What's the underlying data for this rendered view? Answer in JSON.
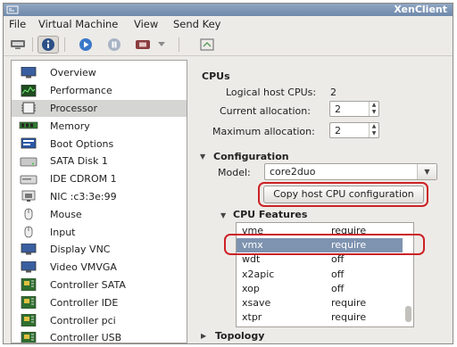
{
  "window": {
    "title": "XenClient",
    "app_icon": "vm-icon"
  },
  "menu": [
    "File",
    "Virtual Machine",
    "View",
    "Send Key"
  ],
  "toolbar": {
    "buttons": [
      "console-icon",
      "info-icon",
      "play-icon",
      "pause-icon",
      "stop-icon",
      "dropdown-arrow-icon",
      "screenshot-icon"
    ]
  },
  "sidebar": {
    "items": [
      {
        "label": "Overview",
        "icon": "monitor-icon"
      },
      {
        "label": "Performance",
        "icon": "performance-graph-icon"
      },
      {
        "label": "Processor",
        "icon": "chip-icon",
        "selected": true
      },
      {
        "label": "Memory",
        "icon": "memory-icon"
      },
      {
        "label": "Boot Options",
        "icon": "boot-options-icon"
      },
      {
        "label": "SATA Disk 1",
        "icon": "disk-icon"
      },
      {
        "label": "IDE CDROM 1",
        "icon": "cdrom-icon"
      },
      {
        "label": "NIC :c3:3e:99",
        "icon": "network-icon"
      },
      {
        "label": "Mouse",
        "icon": "mouse-icon"
      },
      {
        "label": "Input",
        "icon": "keyboard-icon"
      },
      {
        "label": "Display VNC",
        "icon": "display-icon"
      },
      {
        "label": "Video VMVGA",
        "icon": "video-icon"
      },
      {
        "label": "Controller SATA",
        "icon": "controller-icon"
      },
      {
        "label": "Controller IDE",
        "icon": "controller-icon"
      },
      {
        "label": "Controller pci",
        "icon": "controller-icon"
      },
      {
        "label": "Controller USB",
        "icon": "controller-icon"
      }
    ]
  },
  "cpus": {
    "title": "CPUs",
    "logical_label": "Logical host CPUs:",
    "logical_value": "2",
    "current_label": "Current allocation:",
    "current_value": "2",
    "max_label": "Maximum allocation:",
    "max_value": "2"
  },
  "configuration": {
    "title": "Configuration",
    "model_label": "Model:",
    "model_value": "core2duo",
    "copy_button": "Copy host CPU configuration"
  },
  "cpu_features": {
    "title": "CPU Features",
    "rows": [
      {
        "name": "vme",
        "value": "require"
      },
      {
        "name": "vmx",
        "value": "require",
        "selected": true
      },
      {
        "name": "wdt",
        "value": "off"
      },
      {
        "name": "x2apic",
        "value": "off"
      },
      {
        "name": "xop",
        "value": "off"
      },
      {
        "name": "xsave",
        "value": "require"
      },
      {
        "name": "xtpr",
        "value": "require"
      }
    ]
  },
  "topology": {
    "title": "Topology"
  },
  "colors": {
    "titlebar": "#7b93b3",
    "selection": "#7e93b0",
    "callout": "#cc2225",
    "window_bg": "#edebe8"
  }
}
